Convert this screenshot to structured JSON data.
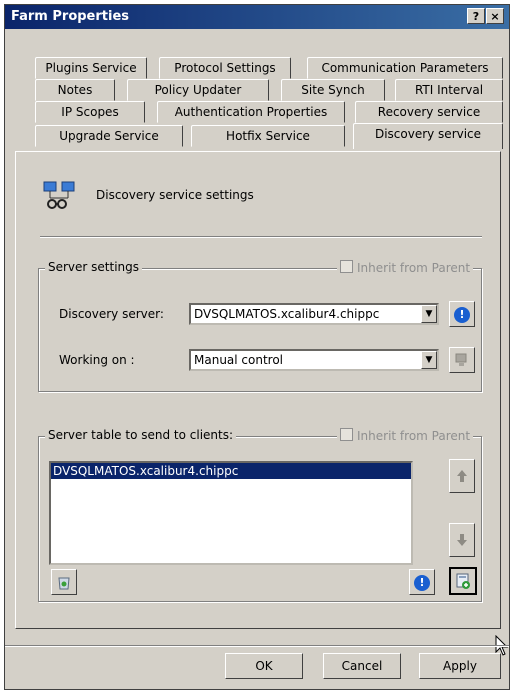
{
  "window": {
    "title": "Farm Properties",
    "help_label": "?",
    "close_label": "×"
  },
  "tabs": {
    "row1": [
      "Plugins Service",
      "Protocol Settings",
      "Communication Parameters"
    ],
    "row2": [
      "Notes",
      "Policy Updater",
      "Site Synch",
      "RTI Interval"
    ],
    "row3": [
      "IP Scopes",
      "Authentication Properties",
      "Recovery service"
    ],
    "row4": [
      "Upgrade Service",
      "Hotfix Service",
      "Discovery service"
    ],
    "active": "Discovery service"
  },
  "header": {
    "title": "Discovery service settings",
    "icon": "network-computers-icon"
  },
  "server_settings": {
    "title": "Server settings",
    "inherit_label": "Inherit from Parent",
    "discovery_label": "Discovery server:",
    "discovery_value": "DVSQLMATOS.xcalibur4.chippc",
    "working_label": "Working on :",
    "working_value": "Manual control"
  },
  "server_table": {
    "title": "Server table to send to clients:",
    "inherit_label": "Inherit from Parent",
    "items": [
      "DVSQLMATOS.xcalibur4.chippc"
    ]
  },
  "buttons": {
    "ok": "OK",
    "cancel": "Cancel",
    "apply": "Apply"
  },
  "colors": {
    "titlebar": "#0a246a",
    "selection": "#0a246a",
    "info": "#1a5fd0"
  }
}
